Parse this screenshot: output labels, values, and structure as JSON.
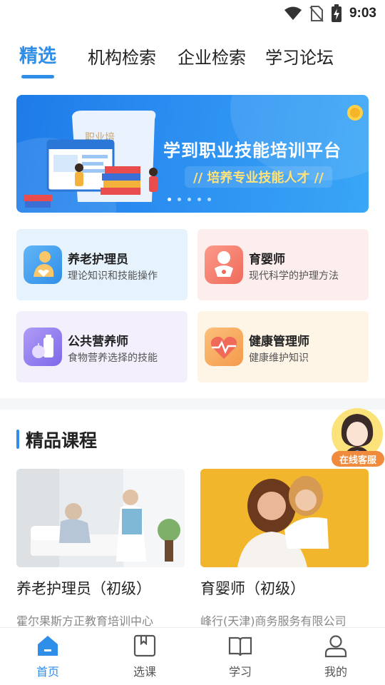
{
  "status_bar": {
    "time": "9:03"
  },
  "top_tabs": [
    {
      "label": "精选"
    },
    {
      "label": "机构检索"
    },
    {
      "label": "企业检索"
    },
    {
      "label": "学习论坛"
    }
  ],
  "banner": {
    "title": "学到职业技能培训平台",
    "subtitle": "// 培养专业技能人才 //"
  },
  "categories": [
    {
      "title": "养老护理员",
      "desc": "理论知识和技能操作",
      "icon": "elder-care-icon",
      "color": "#3d9cf0"
    },
    {
      "title": "育婴师",
      "desc": "现代科学的护理方法",
      "icon": "baby-icon",
      "color": "#f57b6b"
    },
    {
      "title": "公共营养师",
      "desc": "食物营养选择的技能",
      "icon": "nutrition-icon",
      "color": "#8f7bef"
    },
    {
      "title": "健康管理师",
      "desc": "健康维护知识",
      "icon": "heart-pulse-icon",
      "color": "#f5a25a"
    }
  ],
  "section": {
    "title": "精品课程"
  },
  "courses": [
    {
      "name": "养老护理员（初级）",
      "org": "霍尔果斯方正教育培训中心"
    },
    {
      "name": "育婴师（初级）",
      "org": "峰行(天津)商务服务有限公司"
    }
  ],
  "service": {
    "label": "在线客服"
  },
  "bottom_nav": [
    {
      "label": "首页",
      "icon": "home-icon"
    },
    {
      "label": "选课",
      "icon": "course-select-icon"
    },
    {
      "label": "学习",
      "icon": "book-icon"
    },
    {
      "label": "我的",
      "icon": "user-icon"
    }
  ],
  "colors": {
    "accent": "#2f8ee8",
    "service_badge": "#f08a3c"
  }
}
